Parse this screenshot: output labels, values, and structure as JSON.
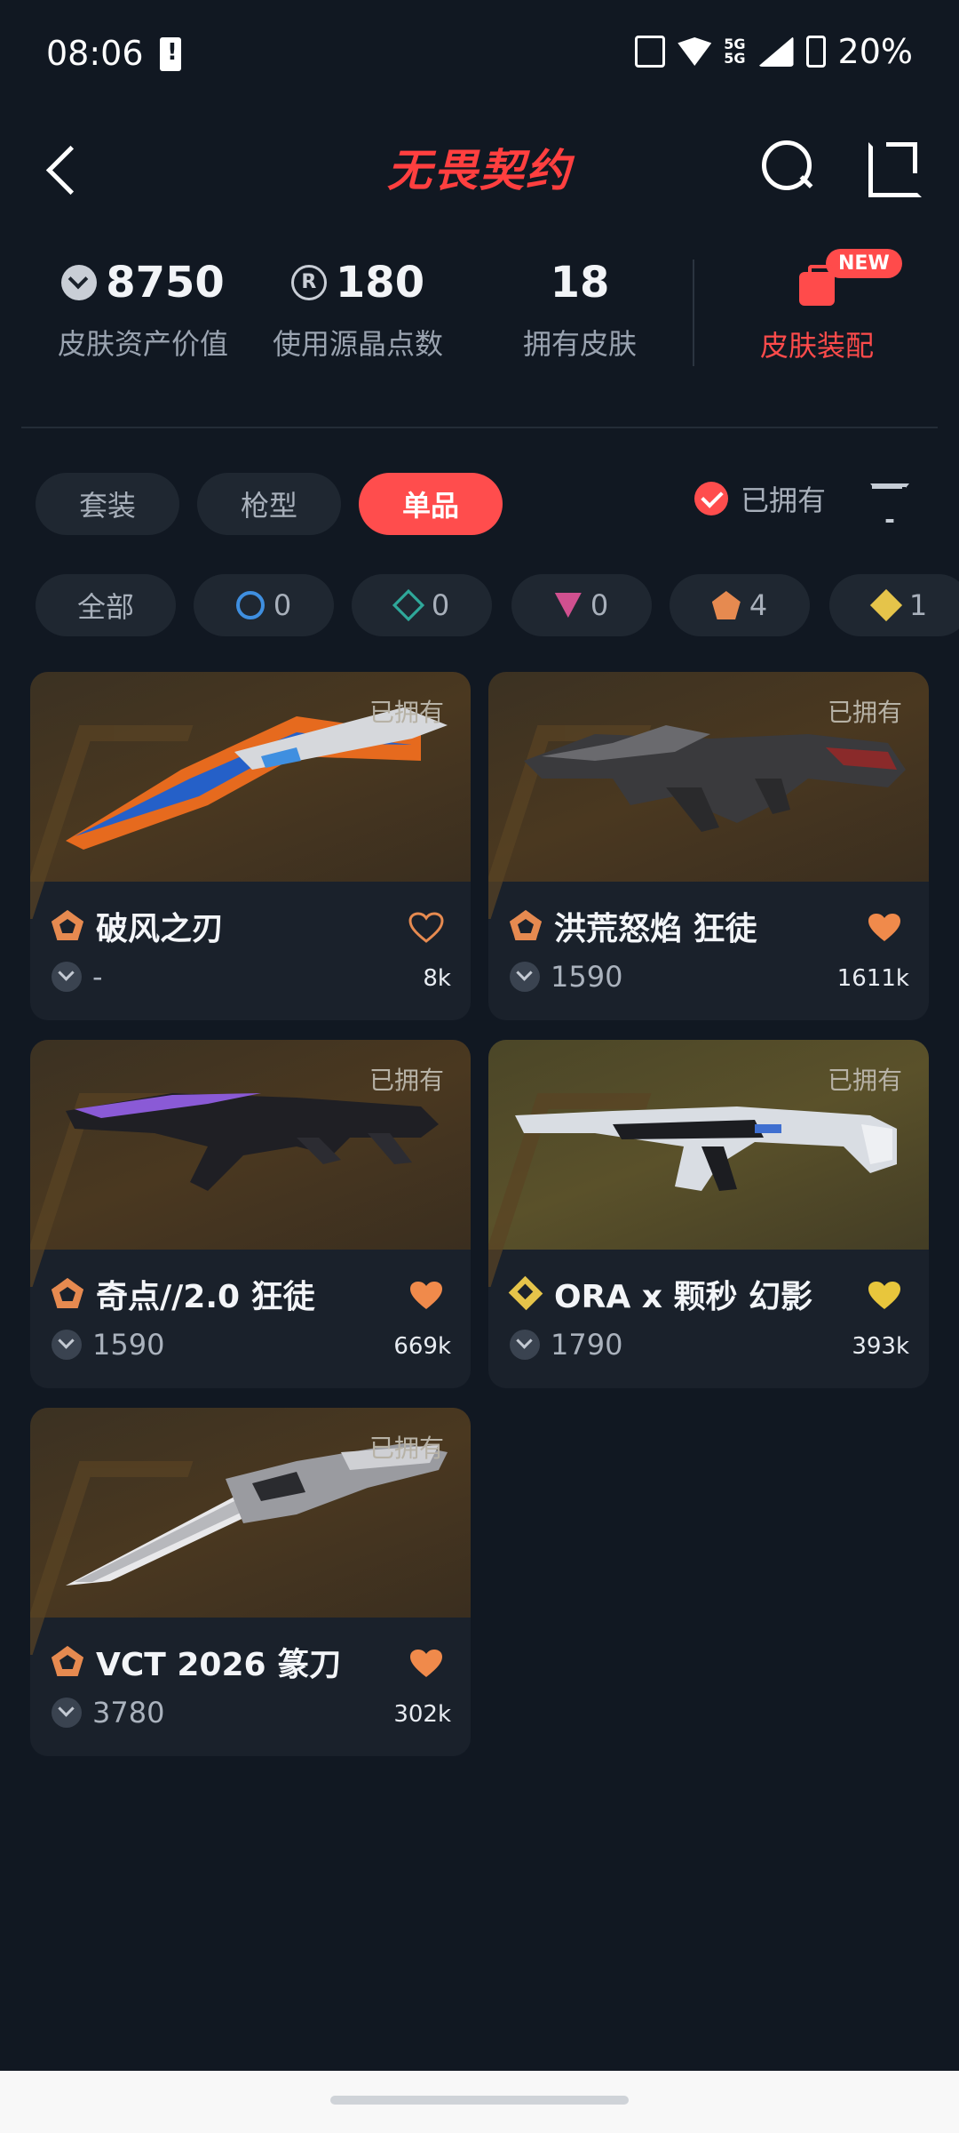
{
  "status_bar": {
    "time": "08:06",
    "battery": "20%",
    "network": "5G"
  },
  "header": {
    "title": "无畏契约"
  },
  "stats": [
    {
      "value": "8750",
      "label": "皮肤资产价值",
      "icon": "vp-coin-icon"
    },
    {
      "value": "180",
      "label": "使用源晶点数",
      "icon": "radianite-icon"
    },
    {
      "value": "18",
      "label": "拥有皮肤",
      "icon": ""
    }
  ],
  "equip": {
    "label": "皮肤装配",
    "badge": "NEW"
  },
  "tabs": [
    {
      "label": "套装",
      "active": false
    },
    {
      "label": "枪型",
      "active": false
    },
    {
      "label": "单品",
      "active": true
    }
  ],
  "owned_filter": {
    "label": "已拥有",
    "checked": true
  },
  "rarity_chips": [
    {
      "label": "全部",
      "count": "",
      "icon": ""
    },
    {
      "label": "",
      "count": "0",
      "icon": "select-tier-icon"
    },
    {
      "label": "",
      "count": "0",
      "icon": "deluxe-tier-icon"
    },
    {
      "label": "",
      "count": "0",
      "icon": "premium-tier-icon"
    },
    {
      "label": "",
      "count": "4",
      "icon": "exclusive-tier-icon"
    },
    {
      "label": "",
      "count": "1",
      "icon": "ultra-tier-icon"
    }
  ],
  "cards": [
    {
      "name": "破风之刃",
      "price": "-",
      "likes": "8k",
      "owned_tag": "已拥有",
      "tier": "orange",
      "liked": false,
      "heart_color": "#e68a50"
    },
    {
      "name": "洪荒怒焰 狂徒",
      "price": "1590",
      "likes": "1611k",
      "owned_tag": "已拥有",
      "tier": "orange",
      "liked": true,
      "heart_color": "#f08a4b"
    },
    {
      "name": "奇点//2.0 狂徒",
      "price": "1590",
      "likes": "669k",
      "owned_tag": "已拥有",
      "tier": "orange",
      "liked": true,
      "heart_color": "#f08a4b"
    },
    {
      "name": "ORA x 颗秒 幻影",
      "price": "1790",
      "likes": "393k",
      "owned_tag": "已拥有",
      "tier": "gold",
      "liked": true,
      "heart_color": "#e8c63c"
    },
    {
      "name": "VCT 2026 篆刀",
      "price": "3780",
      "likes": "302k",
      "owned_tag": "已拥有",
      "tier": "orange",
      "liked": true,
      "heart_color": "#f08a4b"
    }
  ],
  "colors": {
    "accent": "#ff4d4d",
    "background": "#111822",
    "card": "#1a212b"
  }
}
